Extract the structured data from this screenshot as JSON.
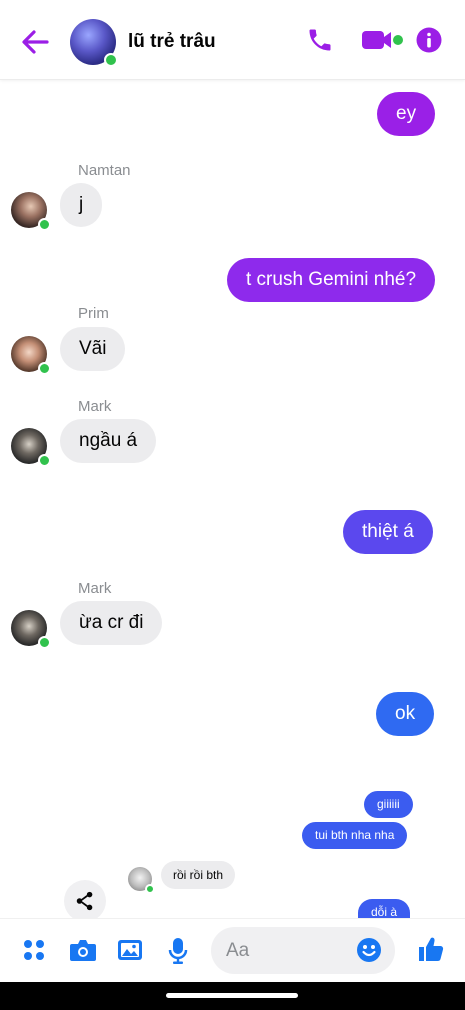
{
  "header": {
    "title": "lũ trẻ trâu",
    "back_icon": "back-arrow-icon",
    "icons": [
      "phone-icon",
      "video-call-icon",
      "info-icon"
    ],
    "accent_color": "#9b1ee6"
  },
  "messages": {
    "m1_out": "ey",
    "m2_sender": "Namtan",
    "m2_text": "j",
    "m3_out": "t crush Gemini nhé?",
    "m4_sender": "Prim",
    "m4_text": "Vãi",
    "m5_sender": "Mark",
    "m5_text": "ngầu á",
    "m6_out": "thiệt á",
    "m7_sender": "Mark",
    "m7_text": "ừa cr đi",
    "m8_out": "ok"
  },
  "shared_preview": {
    "out1": "giiiiii",
    "out2": "tui bth nha nha",
    "in1": "rồi rồi bth",
    "out3": "dỗi à"
  },
  "composer": {
    "placeholder": "Aa",
    "icons": [
      "apps-icon",
      "camera-icon",
      "gallery-icon",
      "microphone-icon",
      "emoji-icon",
      "like-icon"
    ]
  },
  "colors": {
    "outgoing_gradient_top": "#9d1fe7",
    "outgoing_mid": "#6a3cf0",
    "outgoing_bottom": "#2f6af2",
    "incoming_bubble": "#ececee",
    "icon_blue": "#1877f2",
    "online": "#31c24d"
  }
}
